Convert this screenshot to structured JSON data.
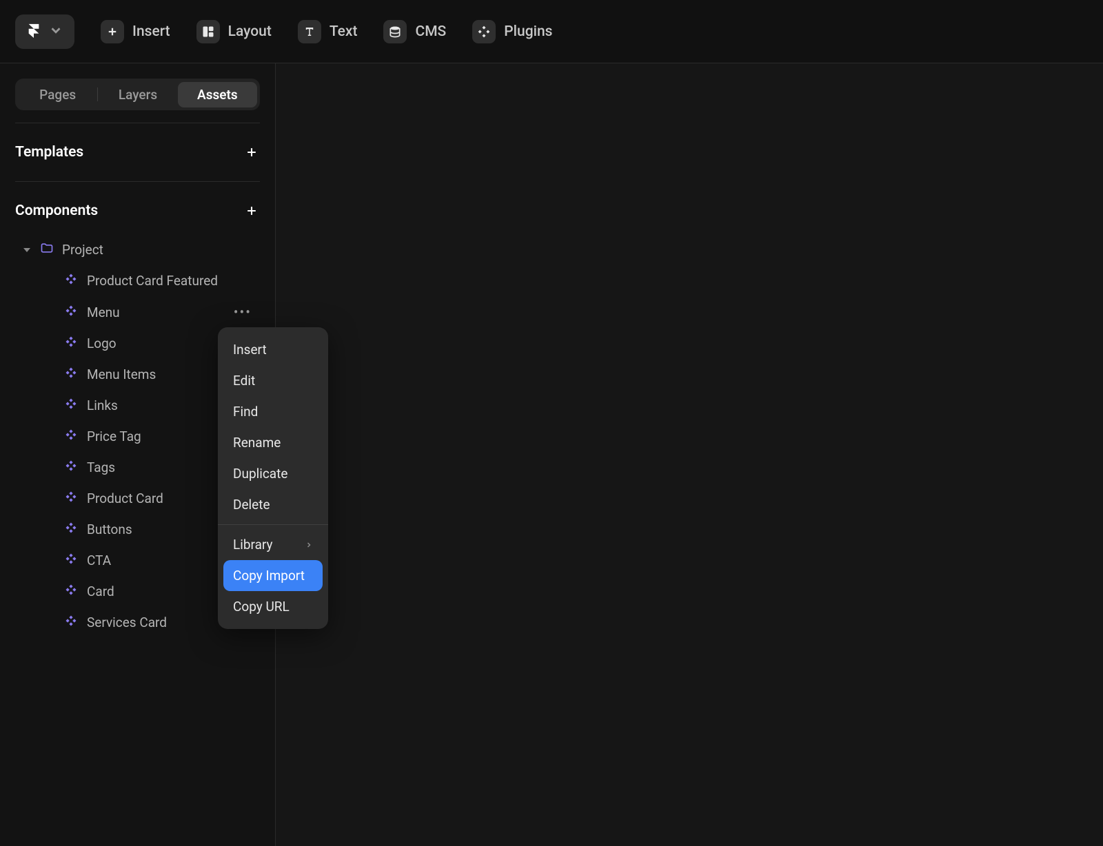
{
  "toolbar": {
    "items": [
      {
        "label": "Insert",
        "icon": "plus-icon"
      },
      {
        "label": "Layout",
        "icon": "layout-icon"
      },
      {
        "label": "Text",
        "icon": "text-icon"
      },
      {
        "label": "CMS",
        "icon": "cms-icon"
      },
      {
        "label": "Plugins",
        "icon": "plugins-icon"
      }
    ]
  },
  "sidebar": {
    "tabs": {
      "pages": "Pages",
      "layers": "Layers",
      "assets": "Assets"
    },
    "activeTab": "Assets",
    "sections": {
      "templates": "Templates",
      "components": "Components"
    },
    "folder": {
      "name": "Project"
    },
    "components": [
      {
        "name": "Product Card Featured"
      },
      {
        "name": "Menu"
      },
      {
        "name": "Logo"
      },
      {
        "name": "Menu Items"
      },
      {
        "name": "Links"
      },
      {
        "name": "Price Tag"
      },
      {
        "name": "Tags"
      },
      {
        "name": "Product Card"
      },
      {
        "name": "Buttons"
      },
      {
        "name": "CTA"
      },
      {
        "name": "Card"
      },
      {
        "name": "Services Card"
      }
    ]
  },
  "contextMenu": {
    "items": [
      {
        "label": "Insert"
      },
      {
        "label": "Edit"
      },
      {
        "label": "Find"
      },
      {
        "label": "Rename"
      },
      {
        "label": "Duplicate"
      },
      {
        "label": "Delete"
      }
    ],
    "secondaryItems": [
      {
        "label": "Library",
        "hasSubmenu": true
      },
      {
        "label": "Copy Import",
        "highlighted": true
      },
      {
        "label": "Copy URL"
      }
    ]
  }
}
